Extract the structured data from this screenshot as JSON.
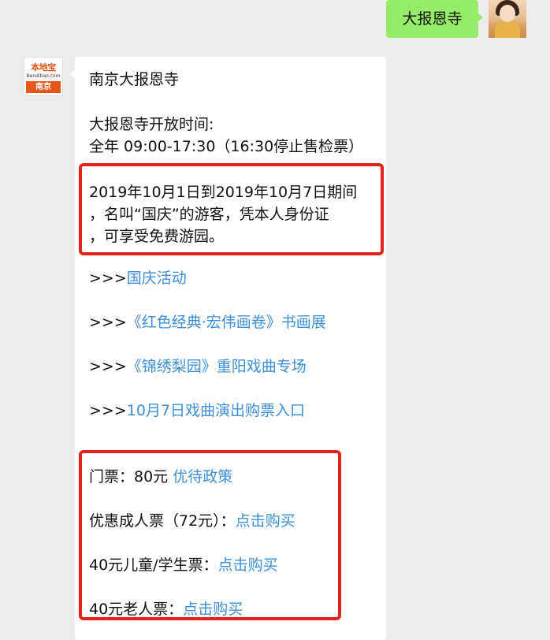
{
  "outgoing": {
    "text": "大报恩寺"
  },
  "bot": {
    "logo_title": "本地宝",
    "logo_url": "Bendibao.com",
    "logo_city": "南京"
  },
  "message": {
    "title": "南京大报恩寺",
    "hours_label": "大报恩寺开放时间:",
    "hours_value": "全年 09:00-17:30（16:30停止售检票）",
    "notice": [
      "2019年10月1日到2019年10月7日期间",
      "，名叫“国庆”的游客，凭本人身份证",
      "，可享受免费游园。"
    ],
    "arrow_prefix": ">>>",
    "links": [
      "国庆活动",
      "《红色经典·宏伟画卷》书画展",
      "《锦绣梨园》重阳戏曲专场",
      "10月7日戏曲演出购票入口"
    ],
    "tickets": {
      "ticket_label": "门票：80元",
      "ticket_policy_link": "优待政策",
      "adult_label": "优惠成人票（72元）：",
      "child_label": "40元儿童/学生票：",
      "senior_label": "40元老人票：",
      "buy_link": "点击购买"
    }
  },
  "colors": {
    "outgoing_bubble": "#95ec69",
    "link": "#3d8fd8",
    "highlight_box": "#e0251b",
    "background": "#ededed"
  }
}
